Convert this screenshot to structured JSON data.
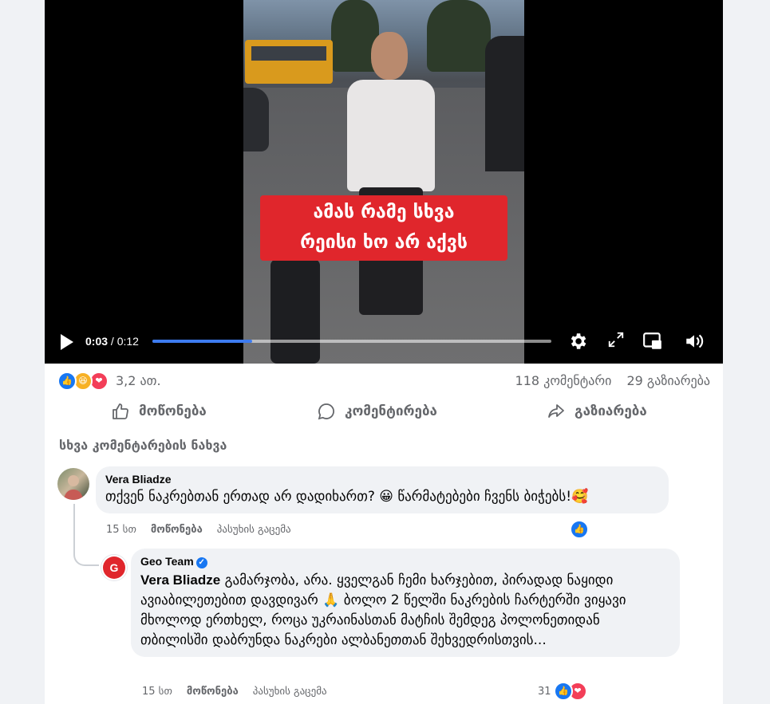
{
  "video": {
    "caption_line1": "ამას რამე სხვა",
    "caption_line2": "რეისი ხო არ აქვს",
    "time_current": "0:03",
    "time_separator": " / ",
    "time_total": "0:12",
    "progress": 0.25
  },
  "reactions": {
    "icons": [
      "like-icon",
      "haha-icon",
      "love-icon"
    ],
    "count": "3,2 ათ.",
    "comments": "118 კომენტარი",
    "shares": "29 გაზიარება"
  },
  "actions": {
    "like_label": "მოწონება",
    "comment_label": "კომენტირება",
    "share_label": "გაზიარება"
  },
  "more_comments": "სხვა კომენტარების ნახვა",
  "comments": [
    {
      "author": "Vera Bliadze",
      "text": "თქვენ ნაკრებთან ერთად არ დადიხართ? 😀 წარმატებები ჩვენს ბიჭებს!🥰",
      "time": "15 სთ",
      "like": "მოწონება",
      "reply": "პასუხის გაცემა"
    }
  ],
  "reply": {
    "author": "Geo Team",
    "mention": "Vera Bliadze",
    "text": " გამარჯობა, არა. ყველგან ჩემი ხარჯებით, პირადად ნაყიდი ავიაბილეთებით დავდივარ 🙏 ბოლო 2 წელში ნაკრების ჩარტერში ვიყავი მხოლოდ ერთხელ, როცა უკრაინასთან მატჩის შემდეგ პოლონეთიდან თბილისში დაბრუნდა ნაკრები ალბანეთთან შეხვედრისთვის...",
    "time": "15 სთ",
    "like": "მოწონება",
    "reply": "პასუხის გაცემა",
    "reaction_count": "31"
  },
  "colors": {
    "accent": "#1877f2",
    "caption_bg": "#e0262c",
    "love": "#f33e58",
    "haha": "#f7b125"
  }
}
